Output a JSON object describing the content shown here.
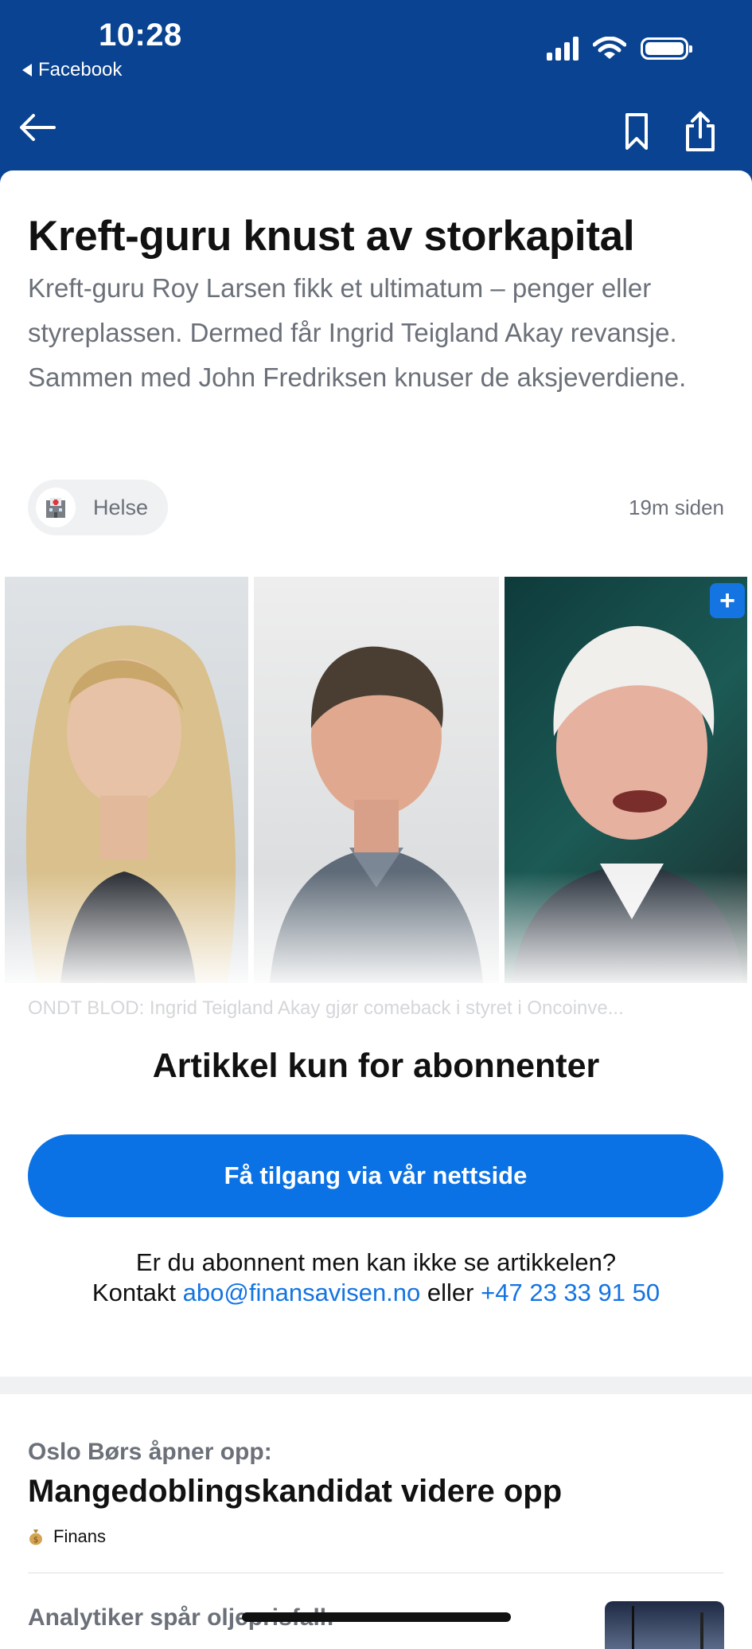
{
  "status_bar": {
    "time": "10:28",
    "back_app": "Facebook"
  },
  "article": {
    "title": "Kreft-guru knust av storkapital",
    "lead": "Kreft-guru Roy Larsen fikk et ultimatum – penger eller styreplassen. Dermed får Ingrid Teigland Akay revansje. Sammen med John Fredriksen knuser de aksjeverdiene.",
    "category": "Helse",
    "category_icon": "hospital-icon",
    "time_ago": "19m siden",
    "image_caption": "ONDT BLOD: Ingrid Teigland Akay gjør comeback i styret i Oncoinve..."
  },
  "paywall": {
    "heading": "Artikkel kun for abonnenter",
    "cta": "Få tilgang via vår nettside",
    "question": "Er du abonnent men kan ikke se artikkelen?",
    "contact_prefix": "Kontakt",
    "email": "abo@finansavisen.no",
    "contact_or": "eller",
    "phone": "+47 23 33 91 50"
  },
  "related": [
    {
      "kicker": "Oslo Børs åpner opp:",
      "title": "Mangedoblingskandidat videre opp",
      "category": "Finans",
      "category_icon": "money-bag-icon"
    },
    {
      "kicker": "Analytiker spår oljeprisfall:"
    }
  ],
  "colors": {
    "header": "#0a4391",
    "accent": "#0a72e4",
    "muted_text": "#6b7079"
  }
}
